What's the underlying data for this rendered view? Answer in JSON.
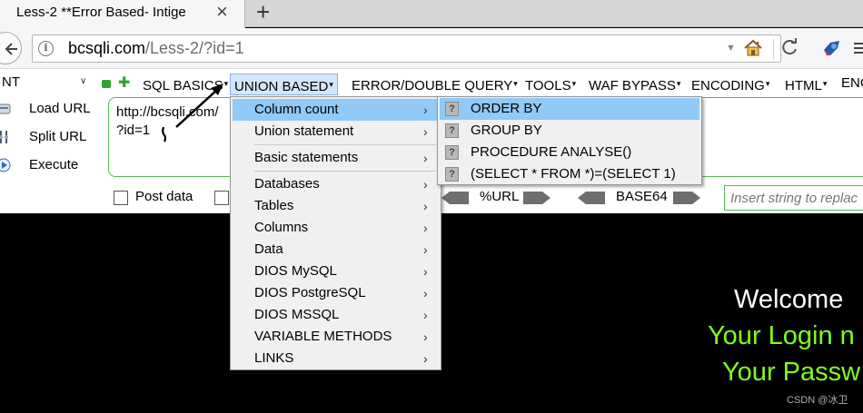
{
  "tab": {
    "title": "Less-2 **Error Based- Intige",
    "close": "×",
    "new_tab": "+"
  },
  "nav": {
    "url_host": "bcsqli.com",
    "url_path": "/Less-2/?id=1",
    "info": "i",
    "dropdown": "▼"
  },
  "hackbar": {
    "select_value": "NT",
    "select_arrow": "∨",
    "menu": [
      {
        "label": "SQL BASICS"
      },
      {
        "label": "UNION BASED"
      },
      {
        "label": "ERROR/DOUBLE QUERY"
      },
      {
        "label": "TOOLS"
      },
      {
        "label": "WAF BYPASS"
      },
      {
        "label": "ENCODING"
      },
      {
        "label": "HTML"
      },
      {
        "label": "ENC"
      }
    ],
    "caret": "▾",
    "buttons": {
      "load": "Load URL",
      "split": "Split URL",
      "execute": "Execute"
    },
    "textarea": "http://bcsqli.com/\n?id=1",
    "post_data": "Post data",
    "encodings": [
      "%URL",
      "BASE64"
    ],
    "insert_placeholder": "Insert string to replac"
  },
  "union_menu": {
    "items": [
      "Column count",
      "Union statement",
      "Basic statements",
      "Databases",
      "Tables",
      "Columns",
      "Data",
      "DIOS MySQL",
      "DIOS PostgreSQL",
      "DIOS MSSQL",
      "VARIABLE METHODS",
      "LINKS"
    ],
    "submenu_arrow": "›"
  },
  "column_count_menu": {
    "items": [
      "ORDER BY",
      "GROUP BY",
      "PROCEDURE ANALYSE()",
      "(SELECT * FROM *)=(SELECT 1)"
    ],
    "icon": "?"
  },
  "page": {
    "welcome": "Welcome",
    "login_line": "Your Login n",
    "pass_line": "Your Passw",
    "watermark": "CSDN @冰卫"
  },
  "colors": {
    "accent_green": "#7dff1c",
    "menu_highlight": "#91c9f7",
    "hackbar_border": "#54b854"
  }
}
